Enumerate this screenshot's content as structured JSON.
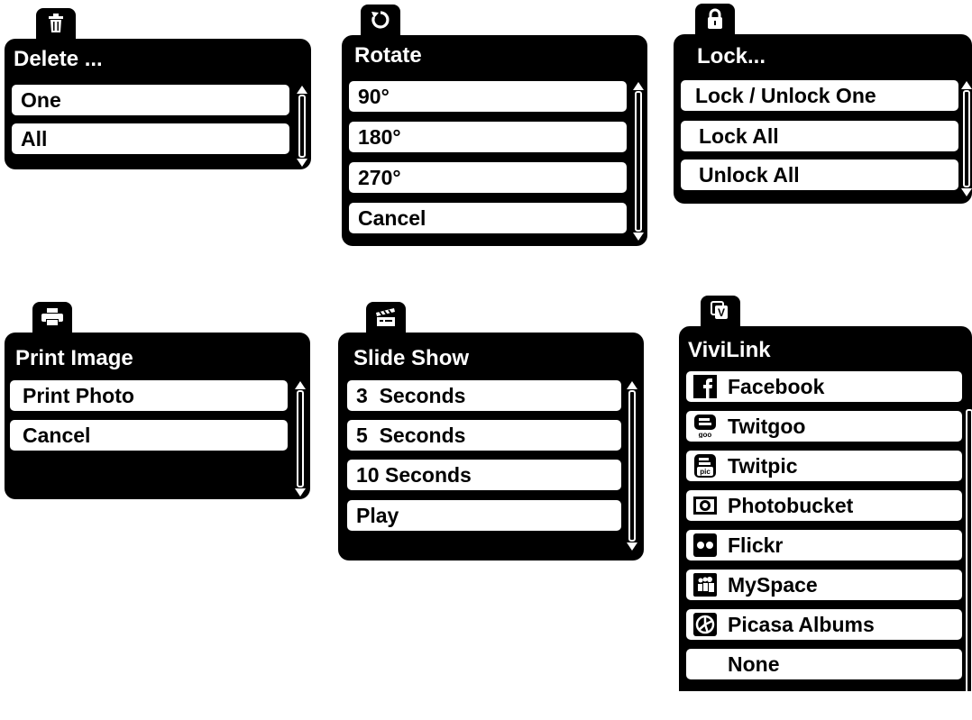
{
  "menus": {
    "delete": {
      "title": "Delete ...",
      "tab_icon": "trash-icon",
      "items": [
        "One",
        "All"
      ]
    },
    "rotate": {
      "title": "Rotate",
      "tab_icon": "rotate-icon",
      "items": [
        "90°",
        "180°",
        "270°",
        "Cancel"
      ]
    },
    "lock": {
      "title": "Lock...",
      "tab_icon": "lock-icon",
      "items": [
        "Lock / Unlock One",
        "Lock All",
        "Unlock All"
      ]
    },
    "print": {
      "title": "Print Image",
      "tab_icon": "printer-icon",
      "items": [
        "Print Photo",
        "Cancel"
      ]
    },
    "slideshow": {
      "title": "Slide Show",
      "tab_icon": "clapperboard-icon",
      "items": [
        "3  Seconds",
        "5  Seconds",
        "10 Seconds",
        "Play"
      ]
    },
    "vivilink": {
      "title": "ViviLink",
      "tab_icon": "vivilink-icon",
      "items": [
        {
          "label": "Facebook",
          "icon": "facebook-icon"
        },
        {
          "label": "Twitgoo",
          "icon": "twitgoo-icon"
        },
        {
          "label": "Twitpic",
          "icon": "twitpic-icon"
        },
        {
          "label": "Photobucket",
          "icon": "photobucket-icon"
        },
        {
          "label": "Flickr",
          "icon": "flickr-icon"
        },
        {
          "label": "MySpace",
          "icon": "myspace-icon"
        },
        {
          "label": "Picasa Albums",
          "icon": "picasa-icon"
        },
        {
          "label": "None",
          "icon": ""
        }
      ]
    }
  }
}
